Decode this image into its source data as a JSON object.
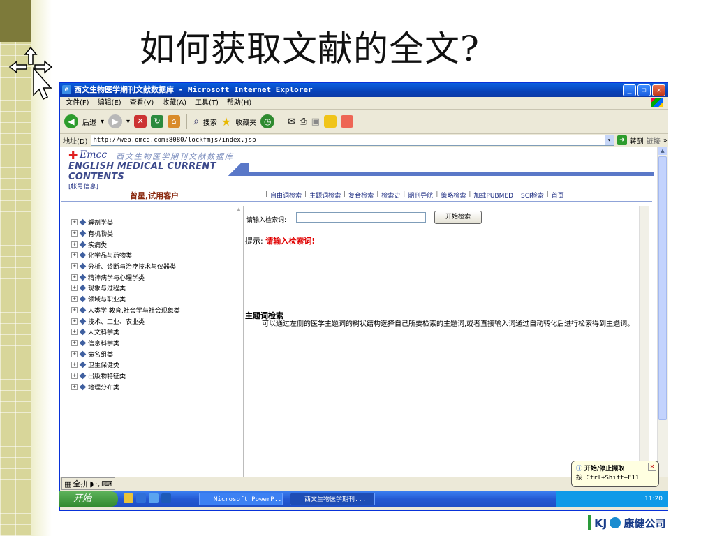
{
  "slide": {
    "title": "如何获取文献的全文?"
  },
  "window": {
    "title": "西文生物医学期刊文献数据库 - Microsoft Internet Explorer",
    "menus": [
      "文件(F)",
      "编辑(E)",
      "查看(V)",
      "收藏(A)",
      "工具(T)",
      "帮助(H)"
    ],
    "toolbar": {
      "back": "后退",
      "search": "搜索",
      "favorites": "收藏夹"
    },
    "address_label": "地址(D)",
    "url": "http://web.omcq.com:8080/lockfmjs/index.jsp",
    "go": "转到",
    "links": "链接"
  },
  "site": {
    "logo_emcc": "Emcc",
    "logo_cn": "西文生物医学期刊文献数据库",
    "logo_en": "ENGLISH MEDICAL CURRENT CONTENTS",
    "account_label": "[帐号信息]",
    "user_text": "曾星,试用客户",
    "nav": [
      "自由词检索",
      "主题词检索",
      "复合检索",
      "检索史",
      "期刊导航",
      "策略检索",
      "加载PUBMED",
      "SCI检索",
      "首页"
    ],
    "tree": [
      "解剖学类",
      "有机物类",
      "疾病类",
      "化学品与药物类",
      "分析、诊断与治疗技术与仪器类",
      "精神病学与心理学类",
      "现象与过程类",
      "领域与职业类",
      "人类学,教育,社会学与社会现象类",
      "技术、工业、农业类",
      "人文科学类",
      "信息科学类",
      "命名组类",
      "卫生保健类",
      "出版物特征类",
      "地理分布类"
    ],
    "search_label": "请输入检索词:",
    "search_value": "",
    "search_button": "开始检索",
    "hint_prefix": "提示:",
    "hint_text": "请输入检索词!",
    "subject_title": "主题词检索",
    "subject_body": "可以通过左侧的医学主题词的树状结构选择自己所要检索的主题词,或者直接输入词通过自动转化后进行检索得到主题词。"
  },
  "taskbar": {
    "start": "开始",
    "tasks": [
      "Microsoft PowerP...",
      "西文生物医学期刊..."
    ],
    "time": "11:20",
    "lang": "全拼"
  },
  "balloon": {
    "title": "开始/停止撷取",
    "body": "按 Ctrl+Shift+F11"
  },
  "brand": {
    "kj": "KJ",
    "name": "康健公司"
  }
}
